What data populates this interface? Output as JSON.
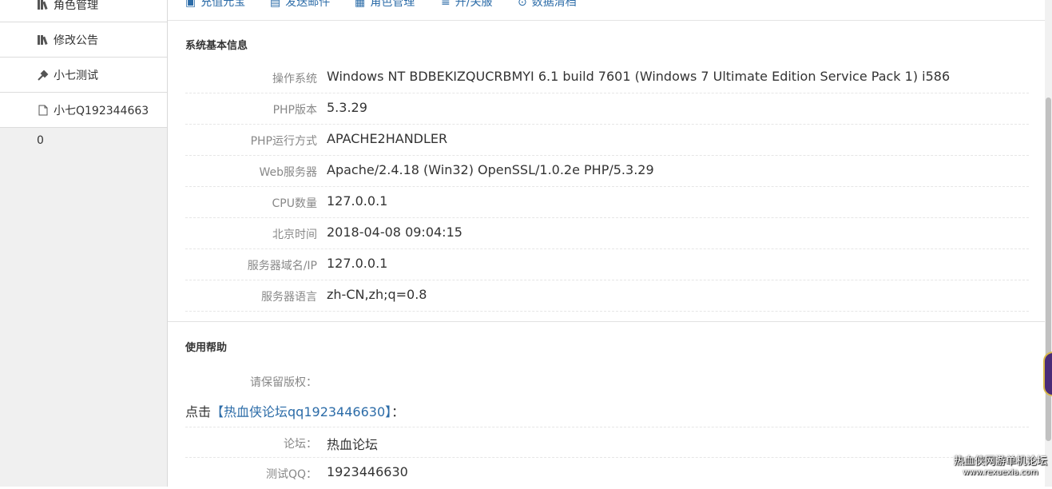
{
  "sidebar": {
    "items": [
      {
        "icon": "bar-chart-icon",
        "label": "角色管理"
      },
      {
        "icon": "bar-chart-icon",
        "label": "修改公告"
      },
      {
        "icon": "wrench-icon",
        "label": "小七测试"
      },
      {
        "icon": "file-icon",
        "label": "小七Q192344663"
      }
    ],
    "extra": "0"
  },
  "topbar": {
    "items": [
      {
        "icon": "recharge-icon",
        "label": "充值元宝"
      },
      {
        "icon": "mail-icon",
        "label": "发送邮件"
      },
      {
        "icon": "role-icon",
        "label": "角色管理"
      },
      {
        "icon": "menu-icon",
        "label": "开/关服"
      },
      {
        "icon": "clean-icon",
        "label": "数据清档"
      }
    ]
  },
  "system_info": {
    "title": "系统基本信息",
    "rows": [
      {
        "label": "操作系统",
        "value": "Windows NT BDBEKIZQUCRBMYI 6.1 build 7601 (Windows 7 Ultimate Edition Service Pack 1) i586"
      },
      {
        "label": "PHP版本",
        "value": "5.3.29"
      },
      {
        "label": "PHP运行方式",
        "value": "APACHE2HANDLER"
      },
      {
        "label": "Web服务器",
        "value": "Apache/2.4.18 (Win32) OpenSSL/1.0.2e PHP/5.3.29"
      },
      {
        "label": "CPU数量",
        "value": "127.0.0.1"
      },
      {
        "label": "北京时间",
        "value": "2018-04-08 09:04:15"
      },
      {
        "label": "服务器域名/IP",
        "value": "127.0.0.1"
      },
      {
        "label": "服务器语言",
        "value": "zh-CN,zh;q=0.8"
      }
    ]
  },
  "help": {
    "title": "使用帮助",
    "copyright_label": "请保留版权：",
    "click_prefix": "点击",
    "link_text": "【热血侠论坛qq1923446630】",
    "click_suffix": "：",
    "forum_label": "论坛：",
    "forum_value": "热血论坛",
    "qq_label": "测试QQ：",
    "qq_value": "1923446630"
  },
  "watermark": {
    "line1": "热血侠网游单机论坛",
    "line2": "www.rexuexia.com"
  },
  "colors": {
    "link": "#2c6ca8",
    "sidebar_bg": "#f0f0f0",
    "label_text": "#888888"
  }
}
